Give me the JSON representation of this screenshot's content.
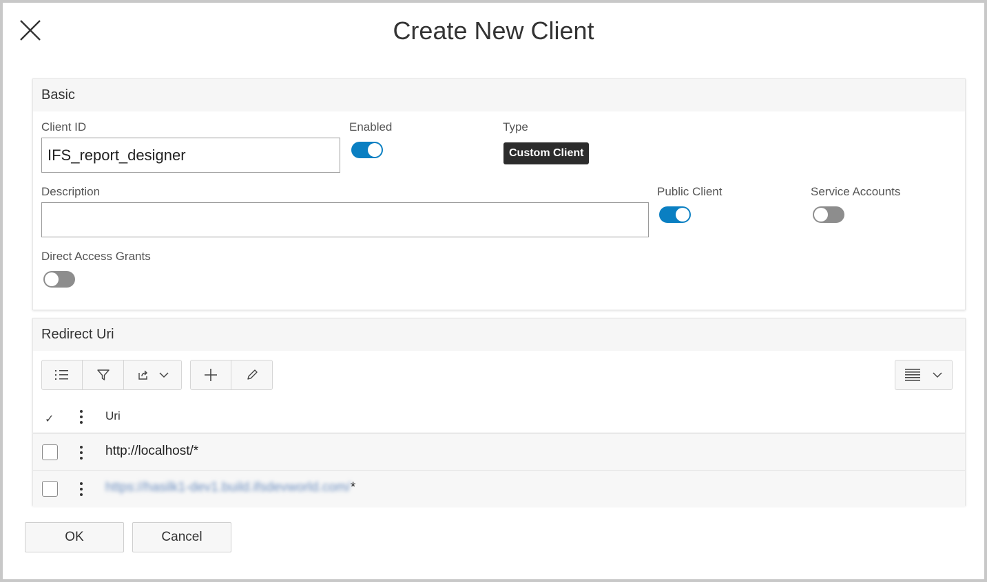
{
  "dialog": {
    "title": "Create New Client"
  },
  "basic": {
    "header": "Basic",
    "client_id": {
      "label": "Client ID",
      "value": "IFS_report_designer"
    },
    "enabled": {
      "label": "Enabled",
      "state": true
    },
    "type": {
      "label": "Type",
      "value": "Custom Client"
    },
    "description": {
      "label": "Description",
      "value": ""
    },
    "public_client": {
      "label": "Public Client",
      "state": true
    },
    "service_accounts": {
      "label": "Service Accounts",
      "state": false
    },
    "direct_access_grants": {
      "label": "Direct Access Grants",
      "state": false
    }
  },
  "redirect": {
    "header": "Redirect Uri",
    "toolbar": [
      "list-icon",
      "filter-icon",
      "export-icon",
      "add-icon",
      "edit-icon",
      "density-icon"
    ],
    "columns": {
      "check": "✓",
      "uri": "Uri"
    },
    "rows": [
      {
        "uri_visible": "http://localhost/*",
        "blurred": ""
      },
      {
        "uri_visible": "*",
        "blurred": "https://hasilk1-dev1.build.ifsdevworld.com/"
      }
    ]
  },
  "footer": {
    "ok": "OK",
    "cancel": "Cancel"
  },
  "colors": {
    "accent": "#0a7fc2",
    "badge": "#2c2c2c",
    "toggle_off": "#8d8d8d"
  }
}
